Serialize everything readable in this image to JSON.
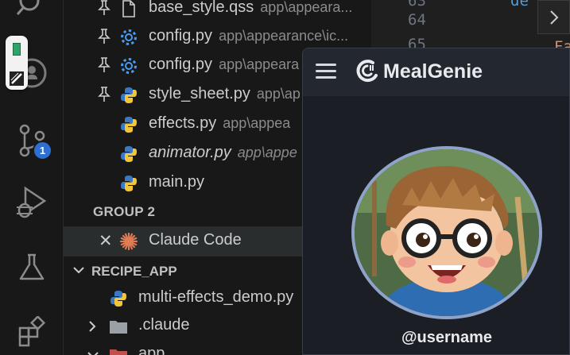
{
  "activity_bar": {
    "source_control_badge": "1",
    "items": [
      "search",
      "floating-app",
      "source-control",
      "run-debug",
      "testing",
      "extensions"
    ]
  },
  "explorer": {
    "open_editors": [
      {
        "name": "base_style.qss",
        "path": "app\\appeara...",
        "icon": "file-icon",
        "pinned": true
      },
      {
        "name": "config.py",
        "path": "app\\appearance\\ic...",
        "icon": "gear-icon",
        "pinned": true
      },
      {
        "name": "config.py",
        "path": "app\\appeara",
        "icon": "gear-icon",
        "pinned": true
      },
      {
        "name": "style_sheet.py",
        "path": "app\\ap",
        "icon": "python-icon",
        "pinned": true
      },
      {
        "name": "effects.py",
        "path": "app\\appea",
        "icon": "python-icon",
        "pinned": false
      },
      {
        "name": "animator.py",
        "path": "app\\appe",
        "icon": "python-icon",
        "pinned": false,
        "italic": true
      },
      {
        "name": "main.py",
        "path": "",
        "icon": "python-icon",
        "pinned": false
      }
    ],
    "group_label": "GROUP 2",
    "group_item": {
      "name": "Claude Code",
      "icon": "claude-icon"
    },
    "section_label": "RECIPE_APP",
    "tree": [
      {
        "name": "multi-effects_demo.py",
        "icon": "python-icon"
      },
      {
        "name": ".claude",
        "icon": "folder-icon"
      },
      {
        "name": "app",
        "icon": "folder-icon"
      }
    ]
  },
  "editor": {
    "line_numbers": [
      "63",
      "64",
      "65"
    ],
    "code_fragments": [
      "de",
      "Fa"
    ]
  },
  "mealgenie": {
    "title": "MealGenie",
    "username": "@username",
    "colors": {
      "header": "#23272f",
      "body": "#1b1e24",
      "avatar_ring": "#8fa3c8"
    }
  }
}
